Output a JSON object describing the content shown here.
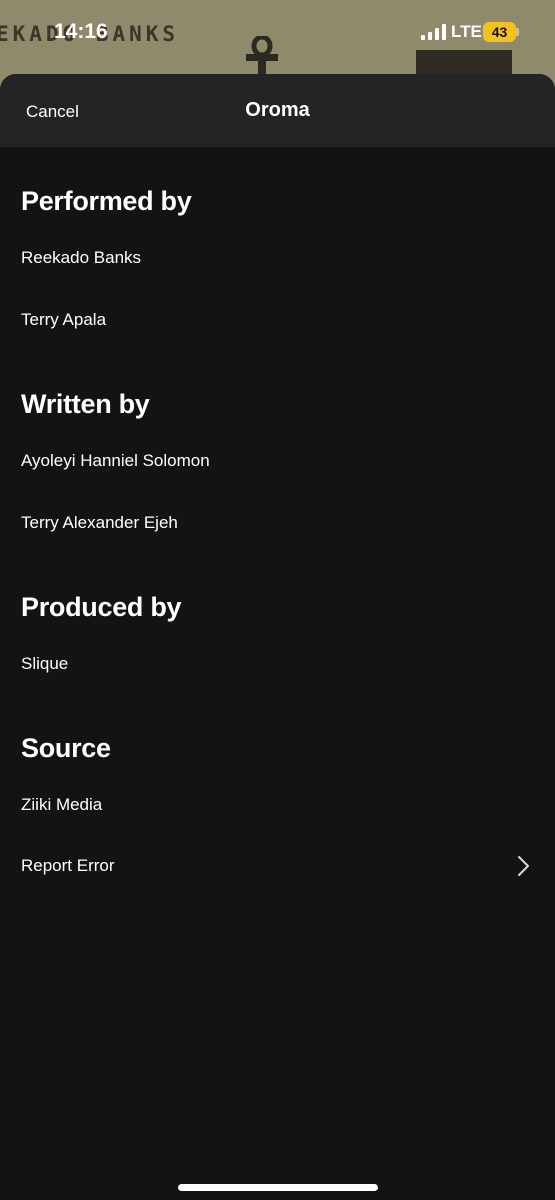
{
  "status_bar": {
    "time": "14:16",
    "network": "LTE",
    "battery": "43",
    "battery_color": "#f5c21b"
  },
  "background": {
    "art_text": "EKADO BANKS"
  },
  "header": {
    "cancel_label": "Cancel",
    "title": "Oroma"
  },
  "sections": {
    "performed": {
      "heading": "Performed by",
      "items": [
        "Reekado Banks",
        "Terry Apala"
      ]
    },
    "written": {
      "heading": "Written by",
      "items": [
        "Ayoleyi Hanniel Solomon",
        "Terry Alexander Ejeh"
      ]
    },
    "produced": {
      "heading": "Produced by",
      "items": [
        "Slique"
      ]
    },
    "source": {
      "heading": "Source",
      "items": [
        "Ziiki Media"
      ]
    }
  },
  "report": {
    "label": "Report Error",
    "icon": "chevron-right-icon"
  },
  "colors": {
    "background": "#131313",
    "header": "#242424",
    "text": "#ffffff"
  }
}
